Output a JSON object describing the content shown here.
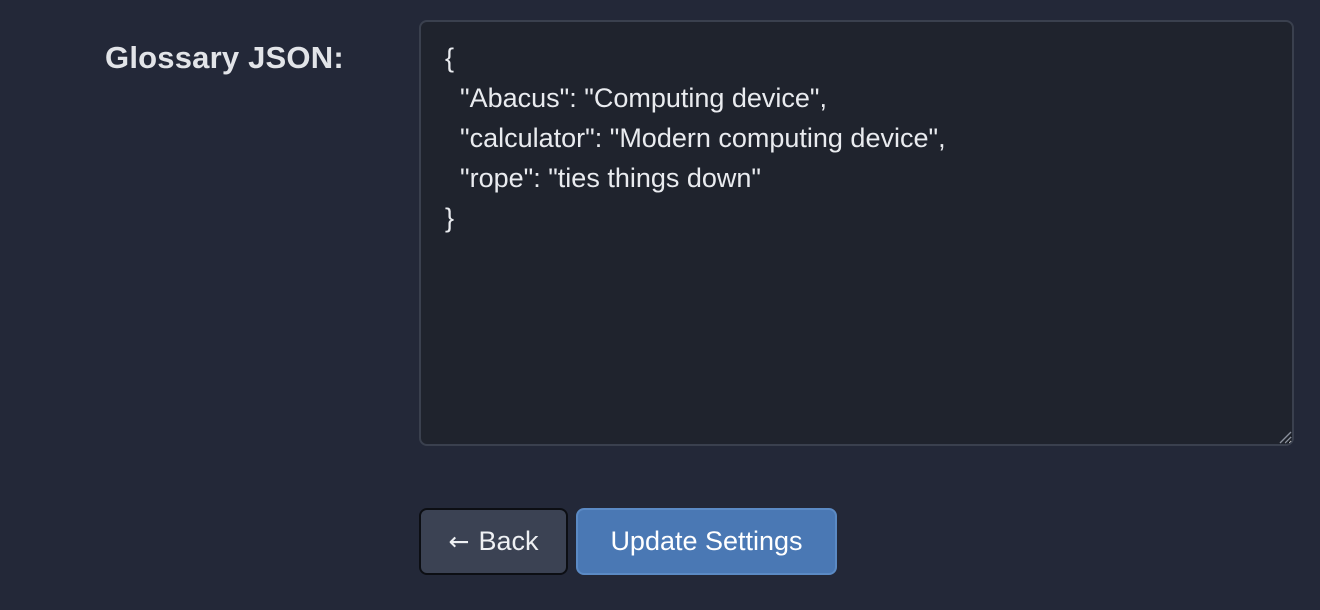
{
  "glossary": {
    "label": "Glossary JSON:",
    "value": "{\n  \"Abacus\": \"Computing device\",\n  \"calculator\": \"Modern computing device\",\n  \"rope\": \"ties things down\"\n}"
  },
  "actions": {
    "back_arrow": "←",
    "back_label": "Back",
    "update_label": "Update Settings"
  },
  "colors": {
    "background": "#232838",
    "editor_background": "#1f232d",
    "back_button": "#3b4253",
    "update_button": "#4a78b4"
  }
}
